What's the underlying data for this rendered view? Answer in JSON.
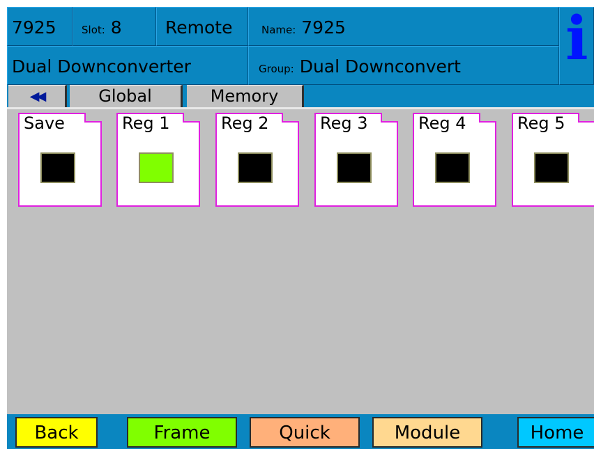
{
  "header": {
    "model": "7925",
    "slot_label": "Slot:",
    "slot_value": "8",
    "mode": "Remote",
    "name_label": "Name:",
    "name_value": "7925",
    "product": "Dual Downconverter",
    "group_label": "Group:",
    "group_value": "Dual Downconvert",
    "info_glyph": "i"
  },
  "tabs": [
    {
      "label": "◀◀",
      "icon": "double-left-arrow-icon"
    },
    {
      "label": "Global"
    },
    {
      "label": "Memory"
    }
  ],
  "registers": [
    {
      "label": "Save",
      "color": "#000000"
    },
    {
      "label": "Reg 1",
      "color": "#80ff00"
    },
    {
      "label": "Reg 2",
      "color": "#000000"
    },
    {
      "label": "Reg 3",
      "color": "#000000"
    },
    {
      "label": "Reg 4",
      "color": "#000000"
    },
    {
      "label": "Reg 5",
      "color": "#000000"
    }
  ],
  "footer": {
    "back": {
      "label": "Back",
      "color": "#ffff00"
    },
    "frame": {
      "label": "Frame",
      "color": "#80ff00"
    },
    "quick": {
      "label": "Quick",
      "color": "#ffb07a"
    },
    "module": {
      "label": "Module",
      "color": "#ffd890"
    },
    "home": {
      "label": "Home",
      "color": "#00c8ff"
    }
  },
  "colors": {
    "header_bg": "#0a86c0",
    "panel_bg": "#c0c0c0",
    "register_border": "#e020e0"
  }
}
